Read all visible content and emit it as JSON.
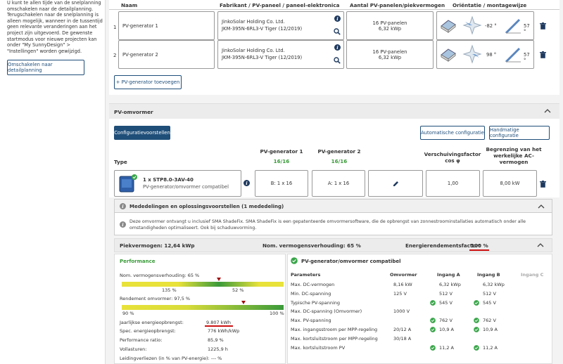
{
  "sidebar": {
    "info_text": "U kunt te allen tijde van de snelplanning omschakelen naar de detailplanning. Terugschakelen naar de snelplanning is alleen mogelijk, wanneer in de tussentijd geen relevante veranderingen aan het project zijn uitgevoerd. De gewenste startmodus voor nieuwe projecten kan onder \"My SunnyDesign\" > \"Instellingen\" worden gewijzigd.",
    "switch_button": "Omschakelen naar detailplanning"
  },
  "generators": {
    "headers": {
      "name": "Naam",
      "manufacturer": "Fabrikant / PV-paneel / paneel-elektronica",
      "count": "Aantal PV-panelen/piekvermogen",
      "orientation": "Oriëntatie / montagewijze"
    },
    "rows": [
      {
        "num": "1",
        "name": "PV-generator 1",
        "manufacturer": "JinkoSolar Holding Co. Ltd.",
        "panel": "JKM-395N-6RL3-V Tiger (12/2019)",
        "panels": "16 PV-panelen",
        "power": "6,32 kWp",
        "azimuth": "-82 °",
        "tilt": "57 °"
      },
      {
        "num": "2",
        "name": "PV-generator 2",
        "manufacturer": "JinkoSolar Holding Co. Ltd.",
        "panel": "JKM-395N-6RL3-V Tiger (12/2019)",
        "panels": "16 PV-panelen",
        "power": "6,32 kWp",
        "azimuth": "98 °",
        "tilt": "57 °"
      }
    ],
    "add_button": "+ PV-generator toevoegen"
  },
  "inverter": {
    "title": "PV-omvormer",
    "config_suggestions": "Configuratievoorstellen",
    "auto_config": "Automatische configuratie",
    "manual_config": "Handmatige configuratie",
    "col_type": "Type",
    "col_gen1": "PV-generator 1",
    "col_gen1_count": "16/16",
    "col_gen2": "PV-generator 2",
    "col_gen2_count": "16/16",
    "col_shift": "Verschuivingsfactor cos φ",
    "col_limit": "Begrenzing van het werkelijke AC-vermogen",
    "model": "1 x STP8.0-3AV-40",
    "compat": "PV-generator/omvormer compatibel",
    "gen1_val": "B: 1 x 16",
    "gen2_val": "A: 1 x 16",
    "shift_val": "1,00",
    "limit_val": "8,00 kW"
  },
  "notices": {
    "title": "Mededelingen en oplossingsvoorstellen (1 mededeling)",
    "text": "Deze omvormer ontvangt u inclusief SMA ShadeFix. SMA ShadeFix is een gepatenteerde omvormersoftware, die de opbrengst van zonnestroominstallaties automatisch onder alle omstandigheden optimaliseert. Ook bij schaduwvorming."
  },
  "summary": {
    "peak": "Piekvermogen: 12,64 kWp",
    "ratio": "Nom. vermogensverhouding: 65 %",
    "efficiency_label": "Energierendementsfactor:",
    "efficiency_value": "100 %"
  },
  "performance": {
    "title": "Performance",
    "ratio_label": "Nom. vermogensverhouding: 65 %",
    "ratio_left": "135 %",
    "ratio_right": "52 %",
    "ratio_marker": 0.6,
    "eff_label": "Rendement omvormer: 97,5 %",
    "eff_left": "90 %",
    "eff_right": "100 %",
    "eff_marker": 0.75,
    "metrics": [
      {
        "label": "Jaarlijkse energieopbrengst:",
        "value": "9.807 kWh"
      },
      {
        "label": "Spec. energieopbrengst:",
        "value": "776 kWh/kWp"
      },
      {
        "label": "Performance ratio:",
        "value": "85,9 %"
      },
      {
        "label": "Vollasturen:",
        "value": "1225,9 h"
      },
      {
        "label": "Leidingverliezen (in % van PV-energie):",
        "value": "--- %"
      }
    ]
  },
  "params": {
    "title": "PV-generator/omvormer compatibel",
    "headers": [
      "Parameters",
      "Omvormer",
      "Ingang A",
      "Ingang B",
      "Ingang C"
    ],
    "rows": [
      {
        "name": "Max. DC-vermogen",
        "inv": "8,16 kW",
        "a": "6,32 kWp",
        "b": "6,32 kWp",
        "check": false
      },
      {
        "name": "Min. DC-spanning",
        "inv": "125 V",
        "a": "512 V",
        "b": "512 V",
        "check": false
      },
      {
        "name": "Typische PV-spanning",
        "inv": "",
        "a": "545 V",
        "b": "545 V",
        "check": true
      },
      {
        "name": "Max. DC-spanning (Omvormer)",
        "inv": "1000 V",
        "a": "",
        "b": "",
        "check": false
      },
      {
        "name": "Max. PV-spanning",
        "inv": "",
        "a": "762 V",
        "b": "762 V",
        "check": true
      },
      {
        "name": "Max. ingangsstroom per MPP-regeling",
        "inv": "20/12 A",
        "a": "10,9 A",
        "b": "10,9 A",
        "check": true
      },
      {
        "name": "Max. kortsluitstroom per MPP-regeling",
        "inv": "30/18 A",
        "a": "",
        "b": "",
        "check": false
      },
      {
        "name": "Max. kortsluitstroom PV",
        "inv": "",
        "a": "11,2 A",
        "b": "11,2 A",
        "check": true
      }
    ]
  }
}
